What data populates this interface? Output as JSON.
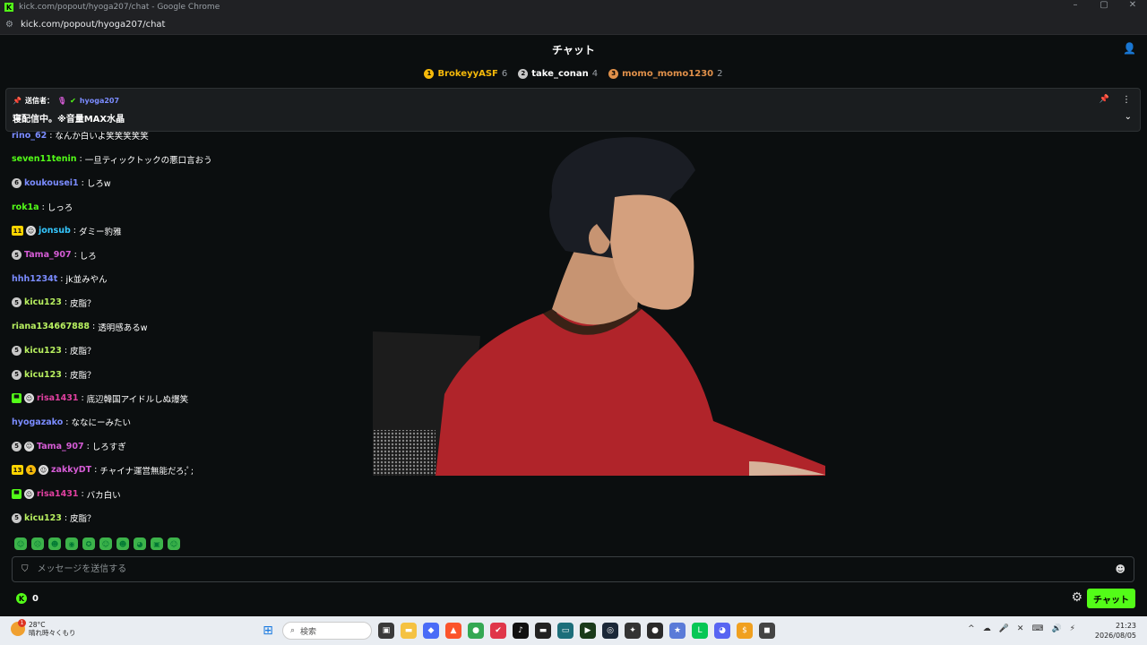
{
  "window": {
    "title": "kick.com/popout/hyoga207/chat - Google Chrome",
    "url": "kick.com/popout/hyoga207/chat",
    "favicon_letter": "K",
    "controls": [
      "–",
      "▢",
      "✕"
    ]
  },
  "header": {
    "title": "チャット"
  },
  "top_gifters": [
    {
      "rank": "1",
      "name": "BrokeyyASF",
      "count": "6",
      "color": "#f5b90a",
      "name_color": "#f5b90a"
    },
    {
      "rank": "2",
      "name": "take_conan",
      "count": "4",
      "color": "#c8c8c8",
      "name_color": "#ffffff"
    },
    {
      "rank": "3",
      "name": "momo_momo1230",
      "count": "2",
      "color": "#e0904a",
      "name_color": "#e0904a"
    }
  ],
  "pinned": {
    "sender_label": "送信者：",
    "sender": "hyoga207",
    "text": "寝配信中。※音量MAX水晶"
  },
  "messages": [
    {
      "badges": [],
      "user": "rino_62",
      "color": "#7b8cff",
      "text": "なんか白いよ笑笑笑笑笑"
    },
    {
      "badges": [],
      "user": "seven11tenin",
      "color": "#53fc18",
      "text": "一旦ティックトックの悪口言おう"
    },
    {
      "badges": [
        "6"
      ],
      "user": "koukousei1",
      "color": "#7b8cff",
      "text": "しろw"
    },
    {
      "badges": [],
      "user": "rok1a",
      "color": "#53fc18",
      "text": "しっろ"
    },
    {
      "badges": [
        "11",
        "bot"
      ],
      "user": "jonsub",
      "color": "#35c8ff",
      "text": "ダミー豹雅"
    },
    {
      "badges": [
        "5"
      ],
      "user": "Tama_907",
      "color": "#d65cd6",
      "text": "しろ"
    },
    {
      "badges": [],
      "user": "hhh1234t",
      "color": "#7b8cff",
      "text": "jk並みやん"
    },
    {
      "badges": [
        "5"
      ],
      "user": "kicu123",
      "color": "#b8f060",
      "text": "皮脂？"
    },
    {
      "badges": [],
      "user": "riana134667888",
      "color": "#b8f060",
      "text": "透明感あるw"
    },
    {
      "badges": [
        "5"
      ],
      "user": "kicu123",
      "color": "#b8f060",
      "text": "皮脂？"
    },
    {
      "badges": [
        "5"
      ],
      "user": "kicu123",
      "color": "#b8f060",
      "text": "皮脂？"
    },
    {
      "badges": [
        "gift",
        "bot"
      ],
      "user": "risa1431",
      "color": "#e040a0",
      "text": "底辺韓国アイドルしぬ爆笑"
    },
    {
      "badges": [],
      "user": "hyogazako",
      "color": "#7b8cff",
      "text": "ななにーみたい"
    },
    {
      "badges": [
        "5",
        "bot"
      ],
      "user": "Tama_907",
      "color": "#d65cd6",
      "text": "しろすぎ"
    },
    {
      "badges": [
        "13",
        "1",
        "bot"
      ],
      "user": "zakkyDT",
      "color": "#d65cd6",
      "text": "チャイナ運営無能だろ;ﾟ;"
    },
    {
      "badges": [
        "gift",
        "bot"
      ],
      "user": "risa1431",
      "color": "#e040a0",
      "text": "バカ白い"
    },
    {
      "badges": [
        "5"
      ],
      "user": "kicu123",
      "color": "#b8f060",
      "text": "皮脂？"
    }
  ],
  "emotes": [
    "☺",
    "☹",
    "☻",
    "◉",
    "✪",
    "☺",
    "☻",
    "◕",
    "▣",
    "☺"
  ],
  "input": {
    "placeholder": "メッセージを送信する"
  },
  "footer": {
    "kicks_count": "0",
    "chat_button": "チャット"
  },
  "taskbar": {
    "temp": "28°C",
    "weather": "晴れ時々くもり",
    "weather_alert": "1",
    "search_placeholder": "検索",
    "time": "21:23",
    "date": "2026/08/05",
    "apps": [
      {
        "name": "task-view",
        "color": "#3a3a3a",
        "glyph": "▣"
      },
      {
        "name": "explorer",
        "color": "#f5c242",
        "glyph": "▬"
      },
      {
        "name": "app-blue",
        "color": "#4a6cf7",
        "glyph": "◆"
      },
      {
        "name": "brave",
        "color": "#fb542b",
        "glyph": "▲"
      },
      {
        "name": "chrome",
        "color": "#34a853",
        "glyph": "●"
      },
      {
        "name": "app-red",
        "color": "#e0364a",
        "glyph": "✔"
      },
      {
        "name": "tiktok",
        "color": "#111111",
        "glyph": "♪"
      },
      {
        "name": "app-dark",
        "color": "#222222",
        "glyph": "▬"
      },
      {
        "name": "app-teal",
        "color": "#1d6e7a",
        "glyph": "▭"
      },
      {
        "name": "app-green",
        "color": "#1a3a1a",
        "glyph": "▶"
      },
      {
        "name": "steam",
        "color": "#1b2838",
        "glyph": "◎"
      },
      {
        "name": "app-dark2",
        "color": "#333333",
        "glyph": "✦"
      },
      {
        "name": "app-obs",
        "color": "#2a2a2a",
        "glyph": "●"
      },
      {
        "name": "app-star",
        "color": "#5a7bd8",
        "glyph": "★"
      },
      {
        "name": "line",
        "color": "#06c755",
        "glyph": "L"
      },
      {
        "name": "discord",
        "color": "#5865f2",
        "glyph": "◕"
      },
      {
        "name": "app-coin",
        "color": "#f0a020",
        "glyph": "$"
      },
      {
        "name": "app-photo",
        "color": "#444444",
        "glyph": "◼"
      }
    ],
    "tray": [
      "^",
      "☁",
      "🎤",
      "✕",
      "⌨",
      "🔊",
      "⚡"
    ]
  }
}
